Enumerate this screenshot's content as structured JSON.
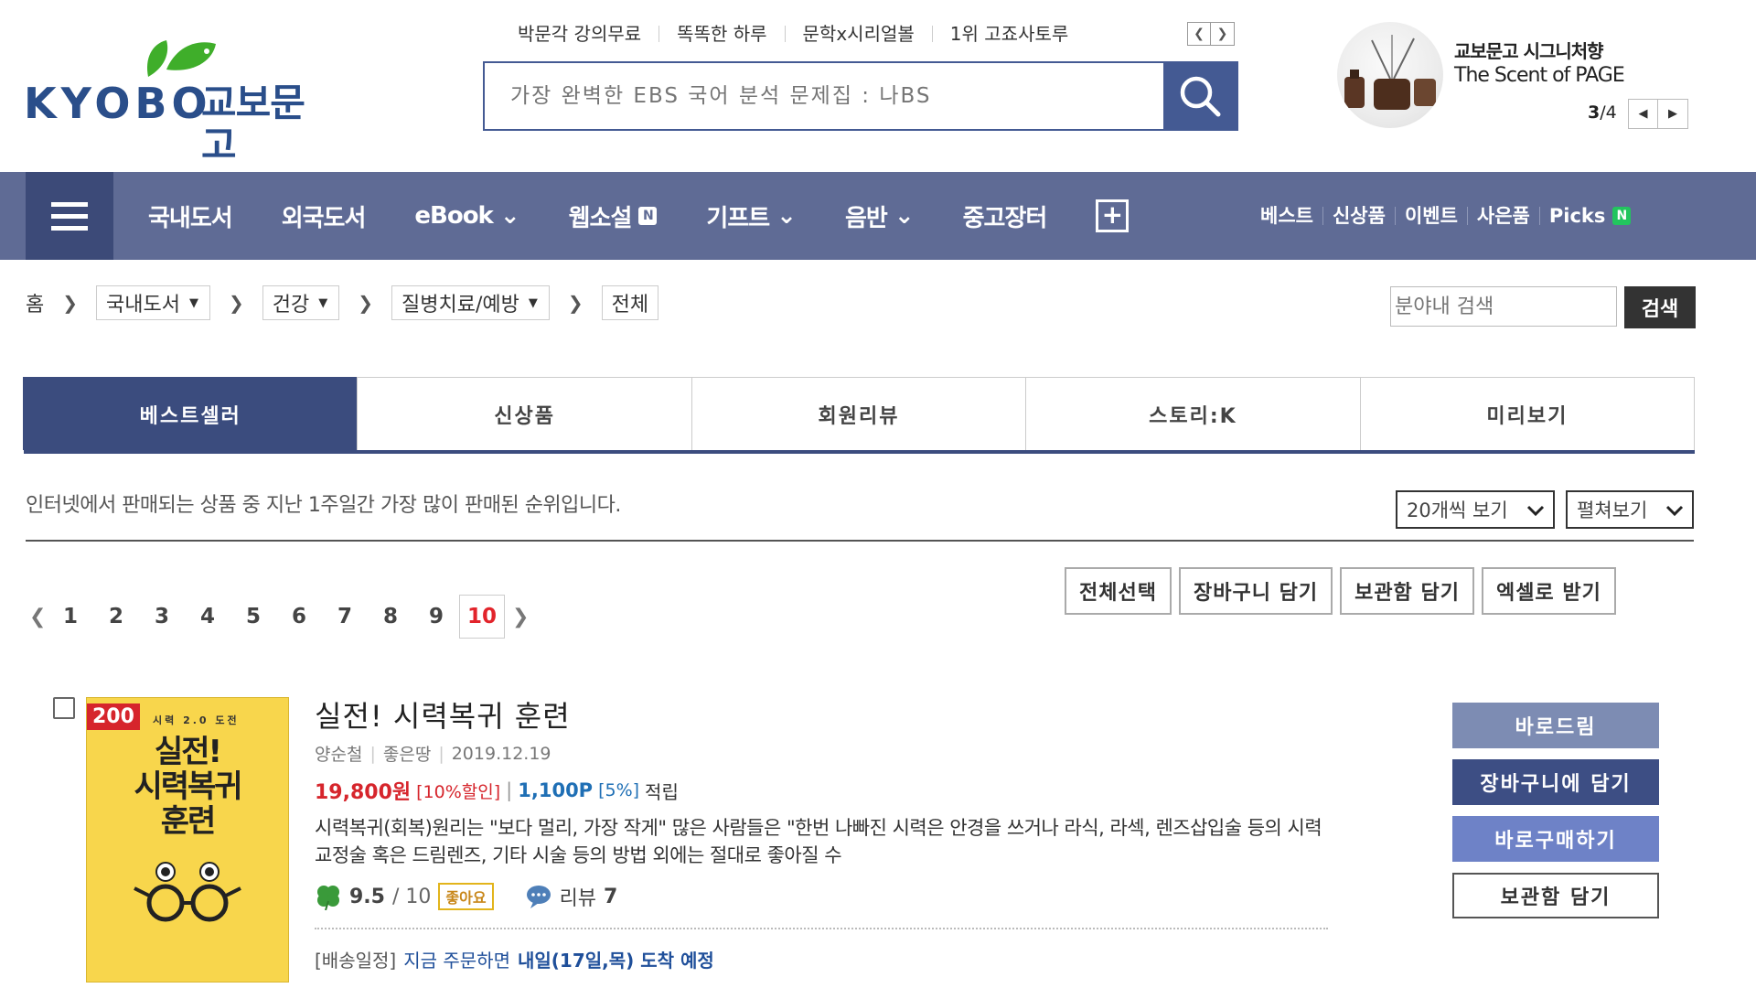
{
  "logo": {
    "word": "KYOBO",
    "kor": "교보문고"
  },
  "quicklinks": [
    "박문각 강의무료",
    "똑똑한 하루",
    "문학x시리얼볼",
    "1위 고죠사토루"
  ],
  "search": {
    "placeholder": "가장 완벽한 EBS 국어 분석 문제집 : 나BS"
  },
  "banner": {
    "line1": "교보문고 시그니처향",
    "line2": "The Scent of PAGE",
    "current": "3",
    "total": "/4"
  },
  "nav": {
    "items": [
      "국내도서",
      "외국도서",
      "eBook",
      "웹소설",
      "기프트",
      "음반",
      "중고장터"
    ],
    "right": [
      "베스트",
      "신상품",
      "이벤트",
      "사은품",
      "Picks"
    ],
    "badge": "N"
  },
  "breadcrumb": {
    "home": "홈",
    "level1": "국내도서",
    "level2": "건강",
    "level3": "질병치료/예방",
    "level4": "전체"
  },
  "inner_search": {
    "placeholder": "분야내 검색",
    "button": "검색"
  },
  "tabs": [
    "베스트셀러",
    "신상품",
    "회원리뷰",
    "스토리:K",
    "미리보기"
  ],
  "description": "인터넷에서 판매되는 상품 중 지난 1주일간 가장 많이 판매된 순위입니다.",
  "selects": {
    "per_page": "20개씩 보기",
    "view_mode": "펼쳐보기"
  },
  "pager": {
    "pages": [
      "1",
      "2",
      "3",
      "4",
      "5",
      "6",
      "7",
      "8",
      "9",
      "10"
    ],
    "current": "10"
  },
  "actions": [
    "전체선택",
    "장바구니 담기",
    "보관함 담기",
    "엑셀로 받기"
  ],
  "product": {
    "rank": "200",
    "cover_top": "시력 2.0 도전",
    "cover_title_1": "실전!",
    "cover_title_2": "시력복귀",
    "cover_title_3": "훈련",
    "title": "실전! 시력복귀 훈련",
    "author": "양순철",
    "publisher": "좋은땅",
    "date": "2019.12.19",
    "price": "19,800원",
    "discount": "[10%할인]",
    "points": "1,100P",
    "points_rate": "[5%]",
    "accumulate": "적립",
    "summary": "시력복귀(회복)원리는 \"보다 멀리, 가장 작게\" 많은 사람들은 \"한번 나빠진 시력은 안경을 쓰거나 라식, 라섹, 렌즈삽입술 등의 시력교정술 혹은 드림렌즈, 기타 시술 등의 방법 외에는 절대로 좋아질 수",
    "rating": "9.5",
    "rating_max": "/ 10",
    "rating_badge": "좋아요",
    "review_label": "리뷰",
    "review_count": "7",
    "ship_label": "[배송일정]",
    "ship_now": "지금 주문하면",
    "ship_date": "내일(17일,목) 도착 예정"
  },
  "side_buttons": [
    "바로드림",
    "장바구니에 담기",
    "바로구매하기",
    "보관함 담기"
  ],
  "colors": {
    "brand": "#2a4e8a",
    "nav": "#5f6b95",
    "tab_active": "#3b4c7e",
    "price": "#d6252c",
    "points": "#1f6fb5"
  }
}
